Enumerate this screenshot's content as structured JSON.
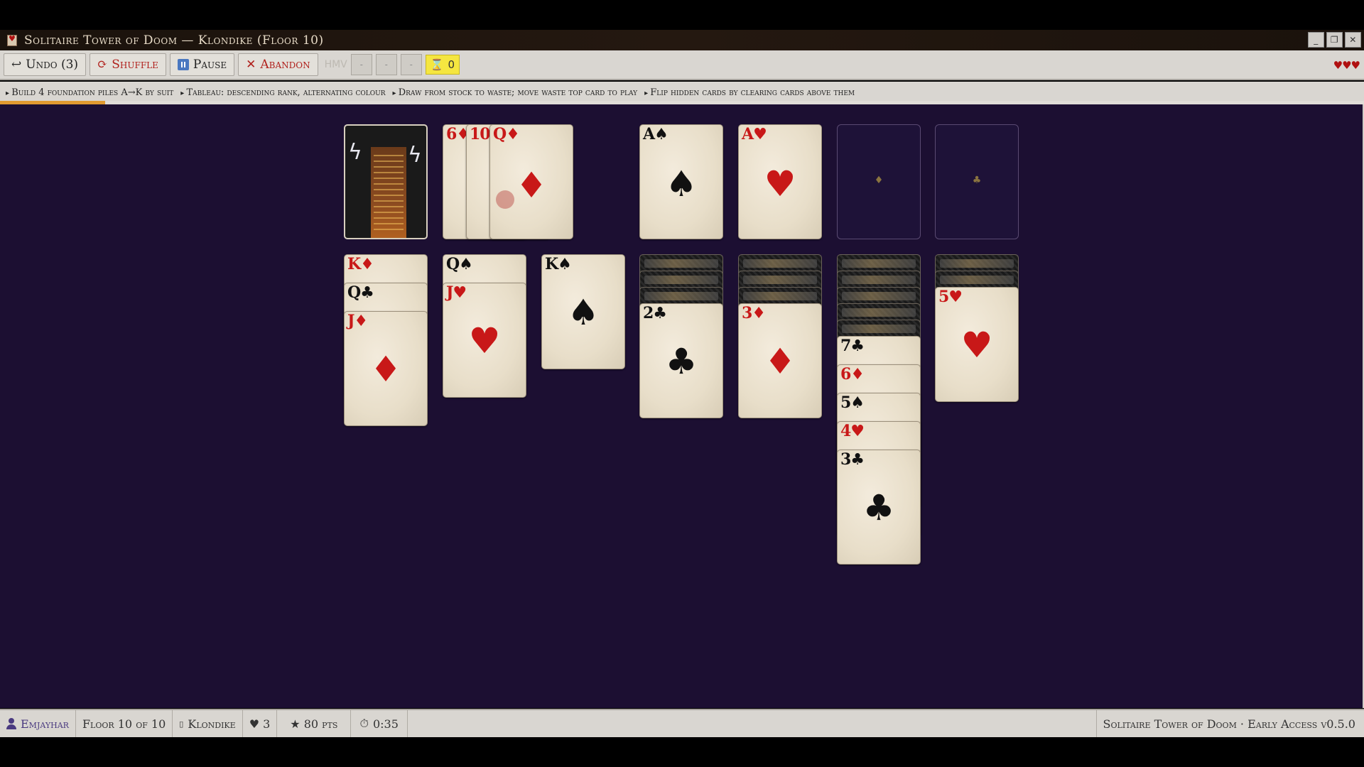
{
  "window": {
    "title": "Solitaire Tower of Doom — Klondike (Floor 10)",
    "controls": [
      "_",
      "❐",
      "✕"
    ]
  },
  "toolbar": {
    "undo_label": "Undo (3)",
    "shuffle_label": "Shuffle",
    "pause_label": "Pause",
    "abandon_label": "Abandon",
    "hmv_label": "HMV",
    "small_buttons": [
      "-",
      "-",
      "-"
    ],
    "moves_count": "0",
    "lives_icons": "♥♥♥"
  },
  "rules": [
    "Build 4 foundation piles A→K by suit",
    "Tableau: descending rank, alternating colour",
    "Draw from stock to waste; move waste top card to play",
    "Flip hidden cards by clearing cards above them"
  ],
  "progress": {
    "fraction": 0.077
  },
  "board": {
    "waste": [
      {
        "rank": "6",
        "suit": "♦",
        "color": "red"
      },
      {
        "rank": "10",
        "suit": "♥",
        "color": "red"
      },
      {
        "rank": "Q",
        "suit": "♦",
        "color": "red"
      }
    ],
    "foundations": [
      {
        "rank": "A",
        "suit": "♠",
        "color": "black"
      },
      {
        "rank": "A",
        "suit": "♥",
        "color": "red"
      },
      {
        "empty": true,
        "pip": "♦"
      },
      {
        "empty": true,
        "pip": "♣"
      }
    ],
    "tableau": [
      {
        "hidden": 0,
        "cards": [
          {
            "rank": "K",
            "suit": "♦",
            "color": "red"
          },
          {
            "rank": "Q",
            "suit": "♣",
            "color": "black"
          },
          {
            "rank": "J",
            "suit": "♦",
            "color": "red"
          }
        ]
      },
      {
        "hidden": 0,
        "cards": [
          {
            "rank": "Q",
            "suit": "♠",
            "color": "black"
          },
          {
            "rank": "J",
            "suit": "♥",
            "color": "red"
          }
        ]
      },
      {
        "hidden": 0,
        "cards": [
          {
            "rank": "K",
            "suit": "♠",
            "color": "black"
          }
        ]
      },
      {
        "hidden": 3,
        "cards": [
          {
            "rank": "2",
            "suit": "♣",
            "color": "black"
          }
        ]
      },
      {
        "hidden": 3,
        "cards": [
          {
            "rank": "3",
            "suit": "♦",
            "color": "red"
          }
        ]
      },
      {
        "hidden": 5,
        "cards": [
          {
            "rank": "7",
            "suit": "♣",
            "color": "black"
          },
          {
            "rank": "6",
            "suit": "♦",
            "color": "red"
          },
          {
            "rank": "5",
            "suit": "♠",
            "color": "black"
          },
          {
            "rank": "4",
            "suit": "♥",
            "color": "red"
          },
          {
            "rank": "3",
            "suit": "♣",
            "color": "black"
          }
        ]
      },
      {
        "hidden": 2,
        "cards": [
          {
            "rank": "5",
            "suit": "♥",
            "color": "red"
          }
        ]
      }
    ]
  },
  "status": {
    "user": "Emjayhar",
    "floor": "Floor 10 of 10",
    "mode": "Klondike",
    "lives": "♥ 3",
    "points": "★ 80 pts",
    "time": "0:35",
    "version": "Solitaire Tower of Doom · Early Access v0.5.0"
  },
  "colors": {
    "felt": "#1c0f32",
    "accent_red": "#c81818",
    "progress": "#e09a30",
    "moves_badge": "#f5e640"
  }
}
